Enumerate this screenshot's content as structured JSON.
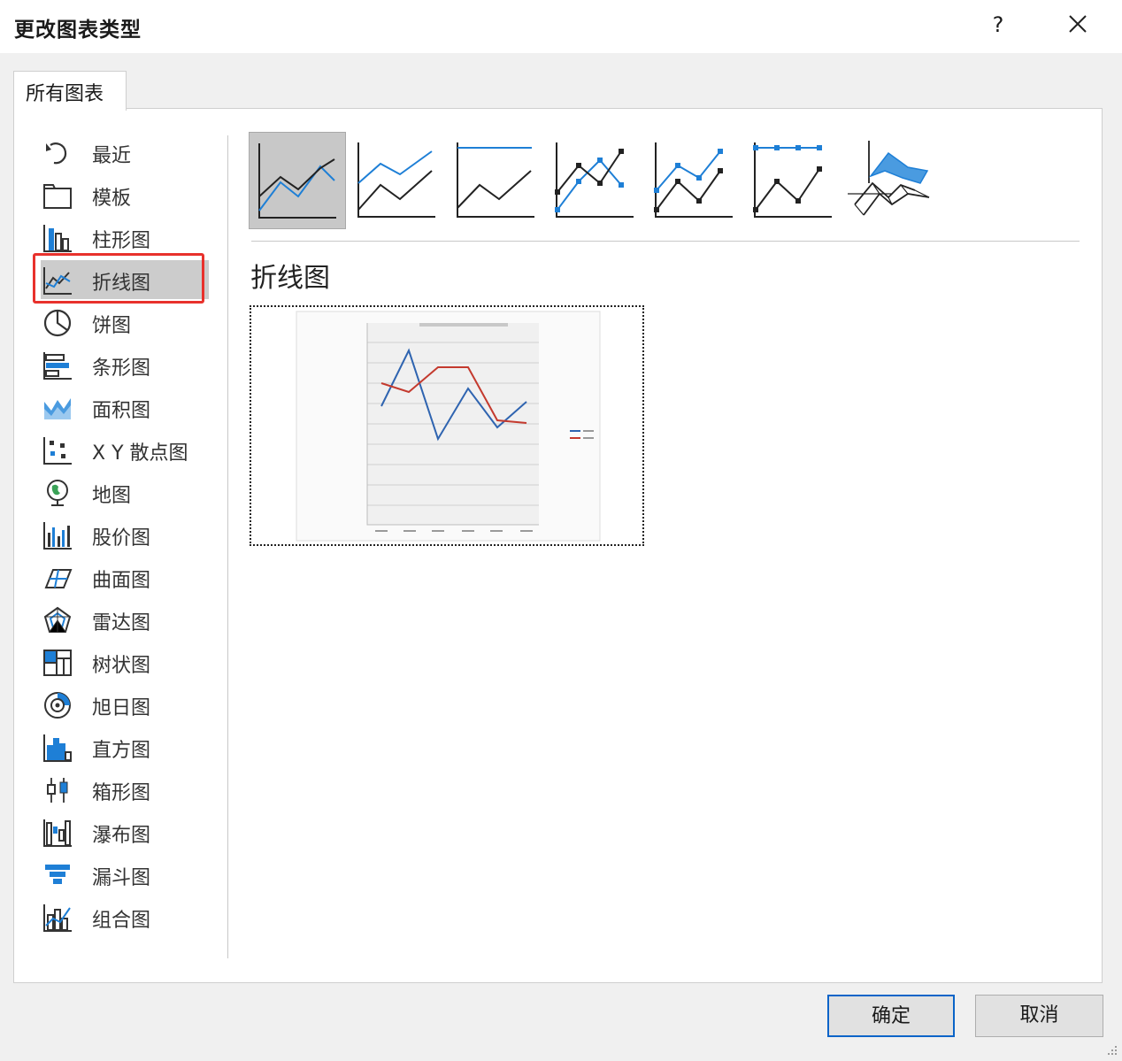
{
  "dialog": {
    "title": "更改图表类型",
    "help_label": "?"
  },
  "tabs": [
    {
      "label": "所有图表"
    }
  ],
  "sidebar": {
    "items": [
      {
        "label": "最近",
        "icon": "recent-icon"
      },
      {
        "label": "模板",
        "icon": "template-folder-icon"
      },
      {
        "label": "柱形图",
        "icon": "column-chart-icon"
      },
      {
        "label": "折线图",
        "icon": "line-chart-icon",
        "selected": true
      },
      {
        "label": "饼图",
        "icon": "pie-chart-icon"
      },
      {
        "label": "条形图",
        "icon": "bar-chart-icon"
      },
      {
        "label": "面积图",
        "icon": "area-chart-icon"
      },
      {
        "label": "X Y 散点图",
        "icon": "scatter-chart-icon"
      },
      {
        "label": "地图",
        "icon": "map-chart-icon"
      },
      {
        "label": "股价图",
        "icon": "stock-chart-icon"
      },
      {
        "label": "曲面图",
        "icon": "surface-chart-icon"
      },
      {
        "label": "雷达图",
        "icon": "radar-chart-icon"
      },
      {
        "label": "树状图",
        "icon": "treemap-chart-icon"
      },
      {
        "label": "旭日图",
        "icon": "sunburst-chart-icon"
      },
      {
        "label": "直方图",
        "icon": "histogram-chart-icon"
      },
      {
        "label": "箱形图",
        "icon": "box-whisker-chart-icon"
      },
      {
        "label": "瀑布图",
        "icon": "waterfall-chart-icon"
      },
      {
        "label": "漏斗图",
        "icon": "funnel-chart-icon"
      },
      {
        "label": "组合图",
        "icon": "combo-chart-icon"
      }
    ]
  },
  "subtypes": [
    {
      "icon": "line-subtype-icon",
      "selected": true
    },
    {
      "icon": "stacked-line-subtype-icon"
    },
    {
      "icon": "100-stacked-line-subtype-icon"
    },
    {
      "icon": "line-with-markers-subtype-icon"
    },
    {
      "icon": "stacked-line-with-markers-subtype-icon"
    },
    {
      "icon": "100-stacked-line-with-markers-subtype-icon"
    },
    {
      "icon": "3d-line-subtype-icon"
    }
  ],
  "preview": {
    "type_title": "折线图"
  },
  "colors": {
    "accent_blue": "#1e7fd6",
    "dark_line": "#222222",
    "preview_series_1": "#2f64b0",
    "preview_series_2": "#c43a2e",
    "selection_red": "#e8312c"
  },
  "buttons": {
    "ok": "确定",
    "cancel": "取消"
  }
}
